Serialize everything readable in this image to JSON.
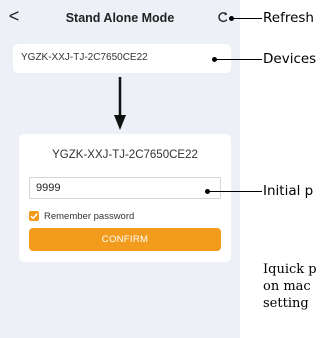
{
  "header": {
    "back_icon": "chevron-left-icon",
    "back_glyph": "<",
    "title": "Stand Alone Mode",
    "refresh_icon": "refresh-icon"
  },
  "device_list": {
    "items": [
      "YGZK-XXJ-TJ-2C7650CE22"
    ]
  },
  "login": {
    "device_name": "YGZK-XXJ-TJ-2C7650CE22",
    "password_value": "9999",
    "remember_checked": true,
    "remember_label": "Remember password",
    "confirm_label": "CONFIRM"
  },
  "annotations": {
    "refresh": "Refresh",
    "devices": "Devices",
    "initial_password": "Initial p",
    "note_lines": [
      "Iquick p",
      "on mac",
      "setting"
    ]
  },
  "colors": {
    "accent": "#f29b1d",
    "background": "#eef0f7",
    "card": "#ffffff"
  }
}
